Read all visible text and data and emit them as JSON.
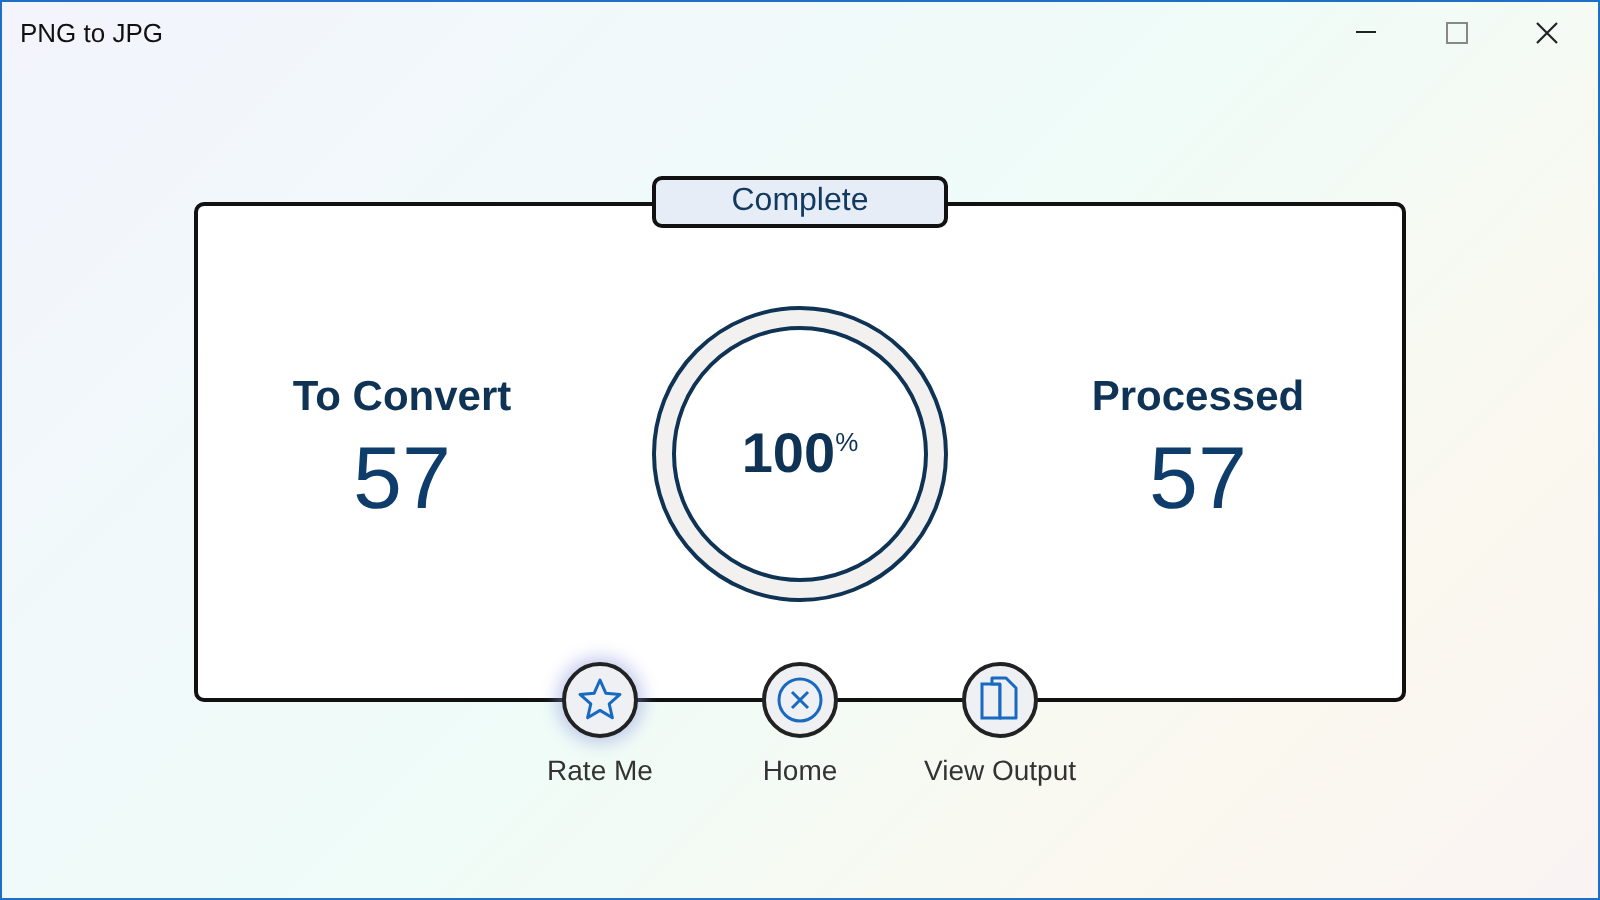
{
  "window": {
    "title": "PNG to JPG"
  },
  "status": "Complete",
  "stats": [
    {
      "label": "To Convert",
      "value": "57"
    },
    {
      "label": "Processed",
      "value": "57"
    }
  ],
  "progress": {
    "value": "100",
    "unit": "%"
  },
  "actions": [
    {
      "kind": "star",
      "label": "Rate Me",
      "selected": true
    },
    {
      "kind": "close",
      "label": "Home",
      "selected": false
    },
    {
      "kind": "copy",
      "label": "View Output",
      "selected": false
    }
  ]
}
